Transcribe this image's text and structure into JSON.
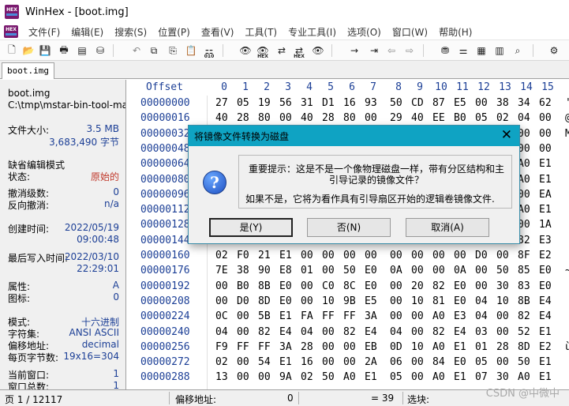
{
  "window": {
    "title": "WinHex - [boot.img]"
  },
  "menu": [
    "文件(F)",
    "编辑(E)",
    "搜索(S)",
    "位置(P)",
    "查看(V)",
    "工具(T)",
    "专业工具(I)",
    "选项(O)",
    "窗口(W)",
    "帮助(H)"
  ],
  "toolbar": {
    "icons": [
      "new-file-icon",
      "open-folder-icon",
      "save-icon",
      "print-icon",
      "properties-icon",
      "open-disk-icon",
      "undo-icon",
      "copy-icon",
      "cut-icon",
      "paste-icon",
      "binary-icon",
      "find-text-icon",
      "find-hex-icon",
      "replace-text-icon",
      "replace-hex-icon",
      "find-again-icon",
      "goto-offset-icon",
      "goto-back-icon",
      "back-icon",
      "forward-icon",
      "disk-editor-icon",
      "ram-editor-icon",
      "chip-icon",
      "calculator-icon",
      "search-icon",
      "settings-icon"
    ],
    "binary_mini": "010",
    "hex_mini": "HEX"
  },
  "tab": {
    "label": "boot.img"
  },
  "info_panel": {
    "filename": "boot.img",
    "path": "C:\\tmp\\mstar-bin-tool-mas",
    "file_size_label": "文件大小:",
    "file_size_mb": "3.5 MB",
    "file_size_bytes": "3,683,490 字节",
    "edit_mode_label": "缺省编辑模式",
    "state_label": "状态:",
    "state_value": "原始的",
    "undo_level_label": "撤消级数:",
    "undo_level_value": "0",
    "reverse_undo_label": "反向撤消:",
    "reverse_undo_value": "n/a",
    "created_label": "创建时间:",
    "created_date": "2022/05/19",
    "created_time": "09:00:48",
    "last_write_label": "最后写入时间:",
    "last_write_date": "2022/03/10",
    "last_write_time": "22:29:01",
    "attr_label": "属性:",
    "attr_value": "A",
    "icon_label": "图标:",
    "icon_value": "0",
    "mode_label": "模式:",
    "mode_value": "十六进制",
    "charset_label": "字符集:",
    "charset_value": "ANSI ASCII",
    "offset_label": "偏移地址:",
    "offset_value": "decimal",
    "bytes_per_page_label": "每页字节数:",
    "bytes_per_page_value": "19x16=304",
    "current_window_label": "当前窗口:",
    "current_window_value": "1",
    "total_windows_label": "窗口总数:",
    "total_windows_value": "1"
  },
  "hex": {
    "offset_header": "Offset",
    "columns": [
      "0",
      "1",
      "2",
      "3",
      "4",
      "5",
      "6",
      "7",
      "8",
      "9",
      "10",
      "11",
      "12",
      "13",
      "14",
      "15"
    ],
    "rows": [
      {
        "offset": "00000000",
        "bytes": [
          "27",
          "05",
          "19",
          "56",
          "31",
          "D1",
          "16",
          "93",
          "50",
          "CD",
          "87",
          "E5",
          "00",
          "38",
          "34",
          "62"
        ],
        "text": "'"
      },
      {
        "offset": "00000016",
        "bytes": [
          "40",
          "28",
          "80",
          "00",
          "40",
          "28",
          "80",
          "00",
          "29",
          "40",
          "EE",
          "B0",
          "05",
          "02",
          "04",
          "00"
        ],
        "text": "@"
      },
      {
        "offset": "00000032",
        "bytes": [
          "",
          "",
          "",
          "",
          "",
          "",
          "",
          "",
          "",
          "",
          "",
          "",
          "",
          "",
          "00",
          "00"
        ],
        "text": "M"
      },
      {
        "offset": "00000048",
        "bytes": [
          "",
          "",
          "",
          "",
          "",
          "",
          "",
          "",
          "",
          "",
          "",
          "",
          "",
          "",
          "00",
          "00"
        ],
        "text": ""
      },
      {
        "offset": "00000064",
        "bytes": [
          "",
          "",
          "",
          "",
          "",
          "",
          "",
          "",
          "",
          "",
          "",
          "",
          "",
          "",
          "A0",
          "E1"
        ],
        "text": ""
      },
      {
        "offset": "00000080",
        "bytes": [
          "",
          "",
          "",
          "",
          "",
          "",
          "",
          "",
          "",
          "",
          "",
          "",
          "",
          "",
          "A0",
          "E1"
        ],
        "text": ""
      },
      {
        "offset": "00000096",
        "bytes": [
          "",
          "",
          "",
          "",
          "",
          "",
          "",
          "",
          "",
          "",
          "",
          "",
          "",
          "",
          "00",
          "EA"
        ],
        "text": ""
      },
      {
        "offset": "00000112",
        "bytes": [
          "",
          "",
          "",
          "",
          "",
          "",
          "",
          "",
          "",
          "",
          "",
          "",
          "",
          "",
          "A0",
          "E1"
        ],
        "text": ""
      },
      {
        "offset": "00000128",
        "bytes": [
          "",
          "",
          "",
          "",
          "",
          "",
          "",
          "",
          "",
          "",
          "",
          "",
          "",
          "",
          "00",
          "1A"
        ],
        "text": ""
      },
      {
        "offset": "00000144",
        "bytes": [
          "",
          "",
          "",
          "",
          "",
          "",
          "",
          "",
          "",
          "",
          "",
          "",
          "",
          "",
          "82",
          "E3"
        ],
        "text": ""
      },
      {
        "offset": "00000160",
        "bytes": [
          "02",
          "F0",
          "21",
          "E1",
          "00",
          "00",
          "00",
          "00",
          "00",
          "00",
          "00",
          "00",
          "D0",
          "00",
          "8F",
          "E2"
        ],
        "text": ""
      },
      {
        "offset": "00000176",
        "bytes": [
          "7E",
          "38",
          "90",
          "E8",
          "01",
          "00",
          "50",
          "E0",
          "0A",
          "00",
          "00",
          "0A",
          "00",
          "50",
          "85",
          "E0"
        ],
        "text": "~"
      },
      {
        "offset": "00000192",
        "bytes": [
          "00",
          "B0",
          "8B",
          "E0",
          "00",
          "C0",
          "8C",
          "E0",
          "00",
          "20",
          "82",
          "E0",
          "00",
          "30",
          "83",
          "E0"
        ],
        "text": ""
      },
      {
        "offset": "00000208",
        "bytes": [
          "00",
          "D0",
          "8D",
          "E0",
          "00",
          "10",
          "9B",
          "E5",
          "00",
          "10",
          "81",
          "E0",
          "04",
          "10",
          "8B",
          "E4"
        ],
        "text": ""
      },
      {
        "offset": "00000224",
        "bytes": [
          "0C",
          "00",
          "5B",
          "E1",
          "FA",
          "FF",
          "FF",
          "3A",
          "00",
          "00",
          "A0",
          "E3",
          "04",
          "00",
          "82",
          "E4"
        ],
        "text": ""
      },
      {
        "offset": "00000240",
        "bytes": [
          "04",
          "00",
          "82",
          "E4",
          "04",
          "00",
          "82",
          "E4",
          "04",
          "00",
          "82",
          "E4",
          "03",
          "00",
          "52",
          "E1"
        ],
        "text": ""
      },
      {
        "offset": "00000256",
        "bytes": [
          "F9",
          "FF",
          "FF",
          "3A",
          "28",
          "00",
          "00",
          "EB",
          "0D",
          "10",
          "A0",
          "E1",
          "01",
          "28",
          "8D",
          "E2"
        ],
        "text": "ù"
      },
      {
        "offset": "00000272",
        "bytes": [
          "02",
          "00",
          "54",
          "E1",
          "16",
          "00",
          "00",
          "2A",
          "06",
          "00",
          "84",
          "E0",
          "05",
          "00",
          "50",
          "E1"
        ],
        "text": ""
      },
      {
        "offset": "00000288",
        "bytes": [
          "13",
          "00",
          "00",
          "9A",
          "02",
          "50",
          "A0",
          "E1",
          "05",
          "00",
          "A0",
          "E1",
          "07",
          "30",
          "A0",
          "E1"
        ],
        "text": ""
      }
    ]
  },
  "status": {
    "page": "页 1 / 12117",
    "offset_label": "偏移地址:",
    "offset_value": "0",
    "equals": "= 39",
    "selection_label": "选块:"
  },
  "watermark": "CSDN @中微中",
  "dialog": {
    "title": "将镜像文件转换为磁盘",
    "message1": "重要提示：这是不是一个像物理磁盘一样，带有分区结构和主引导记录的镜像文件？",
    "message2": "如果不是，它将为看作具有引导扇区开始的逻辑卷镜像文件.",
    "yes": "是(Y)",
    "no": "否(N)",
    "cancel": "取消(A)"
  }
}
